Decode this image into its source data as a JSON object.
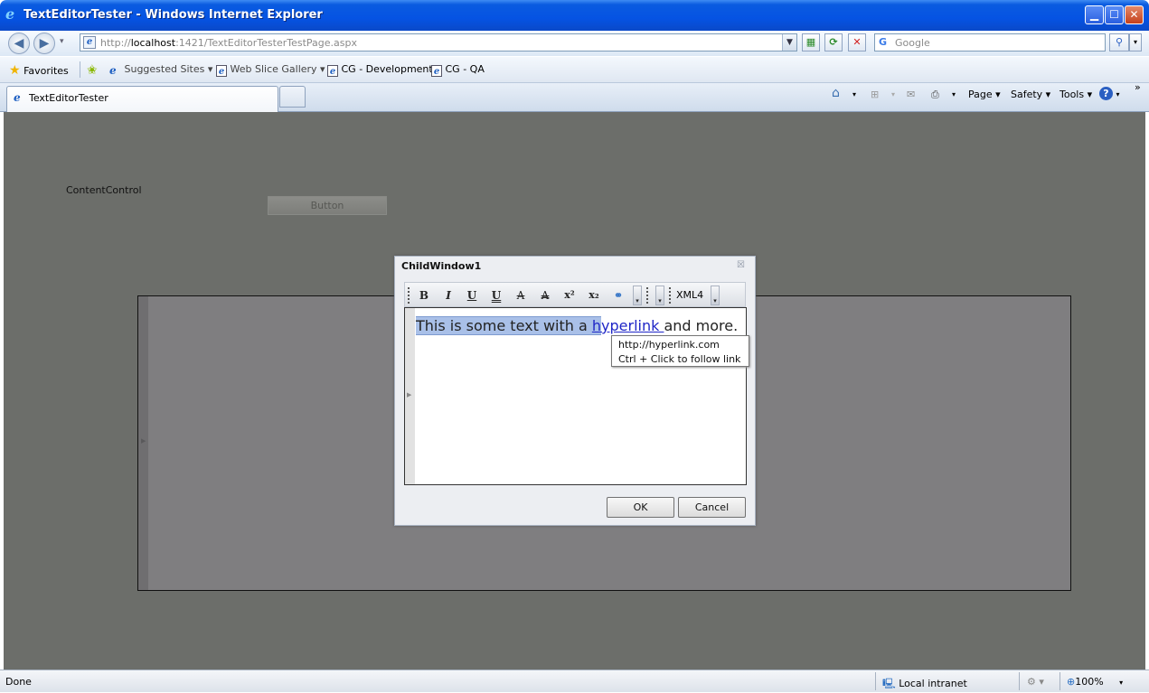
{
  "window": {
    "title": "TextEditorTester - Windows Internet Explorer",
    "minimize": "▁",
    "maximize": "☐",
    "close": "✕"
  },
  "address_bar": {
    "url_prefix": "http://",
    "url_host": "localhost",
    "url_rest": ":1421/TextEditorTesterTestPage.aspx",
    "search_placeholder": "Google"
  },
  "favorites_bar": {
    "favorites_label": "Favorites",
    "items": [
      {
        "label": "Suggested Sites ▾"
      },
      {
        "label": "Web Slice Gallery ▾"
      },
      {
        "label": "CG - Development"
      },
      {
        "label": "CG - QA"
      }
    ]
  },
  "tabs": [
    {
      "label": "TextEditorTester"
    }
  ],
  "command_bar": {
    "page": "Page ▾",
    "safety": "Safety ▾",
    "tools": "Tools ▾",
    "more": "»"
  },
  "content": {
    "content_control_label": "ContentControl",
    "button_label": "Button"
  },
  "child_window": {
    "title": "ChildWindow1",
    "toolbar": {
      "bold": "B",
      "italic": "I",
      "underline": "U",
      "double_underline": "U",
      "strike": "A",
      "double_strike": "A",
      "superscript": "x²",
      "subscript": "x₂",
      "format_dropdown": "XML4"
    },
    "editor": {
      "text_before": "This is some text with a ",
      "link_selected": "h",
      "link_rest": "yperlink ",
      "text_after": "and more."
    },
    "tooltip": {
      "line1": "http://hyperlink.com",
      "line2": "Ctrl + Click to follow link"
    },
    "ok_label": "OK",
    "cancel_label": "Cancel"
  },
  "status_bar": {
    "status": "Done",
    "zone": "Local intranet",
    "zoom": "100%"
  }
}
